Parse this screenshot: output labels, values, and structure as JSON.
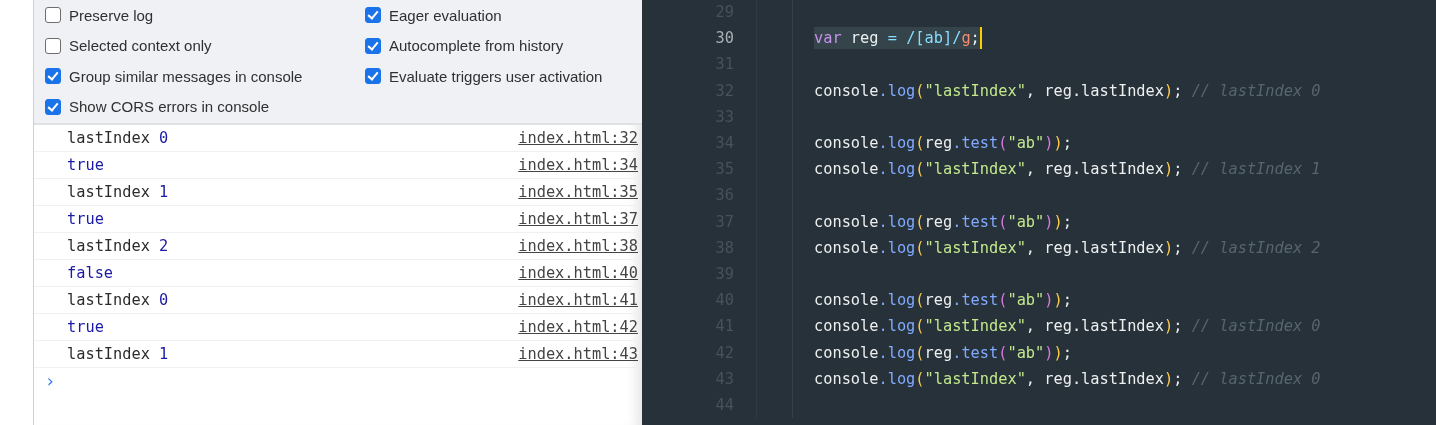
{
  "settings": [
    {
      "label": "Preserve log",
      "checked": false
    },
    {
      "label": "Eager evaluation",
      "checked": true
    },
    {
      "label": "Selected context only",
      "checked": false
    },
    {
      "label": "Autocomplete from history",
      "checked": true
    },
    {
      "label": "Group similar messages in console",
      "checked": true
    },
    {
      "label": "Evaluate triggers user activation",
      "checked": true
    },
    {
      "label": "Show CORS errors in console",
      "checked": true
    }
  ],
  "console_rows": [
    {
      "label": "lastIndex",
      "value": "0",
      "source": "index.html:32"
    },
    {
      "value": "true",
      "source": "index.html:34"
    },
    {
      "label": "lastIndex",
      "value": "1",
      "source": "index.html:35"
    },
    {
      "value": "true",
      "source": "index.html:37"
    },
    {
      "label": "lastIndex",
      "value": "2",
      "source": "index.html:38"
    },
    {
      "value": "false",
      "source": "index.html:40"
    },
    {
      "label": "lastIndex",
      "value": "0",
      "source": "index.html:41"
    },
    {
      "value": "true",
      "source": "index.html:42"
    },
    {
      "label": "lastIndex",
      "value": "1",
      "source": "index.html:43"
    }
  ],
  "console_prompt": "›",
  "editor_lines": [
    {
      "number": "29",
      "current": false
    },
    {
      "number": "30",
      "current": true,
      "tokens": [
        {
          "kind": "keyword",
          "text": "var"
        },
        {
          "kind": "plain",
          "text": " reg "
        },
        {
          "kind": "op",
          "text": "= "
        },
        {
          "kind": "regex",
          "text": "/[ab]/"
        },
        {
          "kind": "flag",
          "text": "g"
        },
        {
          "kind": "plain",
          "text": ";"
        }
      ]
    },
    {
      "number": "31",
      "current": false
    },
    {
      "number": "32",
      "current": false,
      "tokens": [
        {
          "kind": "plain",
          "text": "console"
        },
        {
          "kind": "method",
          "text": ".log"
        },
        {
          "kind": "paren",
          "text": "("
        },
        {
          "kind": "string",
          "text": "\"lastIndex\""
        },
        {
          "kind": "plain",
          "text": ", reg.lastIndex"
        },
        {
          "kind": "paren",
          "text": ")"
        },
        {
          "kind": "plain",
          "text": "; "
        },
        {
          "kind": "comment",
          "text": "// lastIndex 0"
        }
      ]
    },
    {
      "number": "33",
      "current": false
    },
    {
      "number": "34",
      "current": false,
      "tokens": [
        {
          "kind": "plain",
          "text": "console"
        },
        {
          "kind": "method",
          "text": ".log"
        },
        {
          "kind": "paren",
          "text": "("
        },
        {
          "kind": "plain",
          "text": "reg"
        },
        {
          "kind": "method",
          "text": ".test"
        },
        {
          "kind": "paren2",
          "text": "("
        },
        {
          "kind": "string",
          "text": "\"ab\""
        },
        {
          "kind": "paren2",
          "text": ")"
        },
        {
          "kind": "paren",
          "text": ")"
        },
        {
          "kind": "plain",
          "text": ";"
        }
      ]
    },
    {
      "number": "35",
      "current": false,
      "tokens": [
        {
          "kind": "plain",
          "text": "console"
        },
        {
          "kind": "method",
          "text": ".log"
        },
        {
          "kind": "paren",
          "text": "("
        },
        {
          "kind": "string",
          "text": "\"lastIndex\""
        },
        {
          "kind": "plain",
          "text": ", reg.lastIndex"
        },
        {
          "kind": "paren",
          "text": ")"
        },
        {
          "kind": "plain",
          "text": "; "
        },
        {
          "kind": "comment",
          "text": "// lastIndex 1"
        }
      ]
    },
    {
      "number": "36",
      "current": false
    },
    {
      "number": "37",
      "current": false,
      "tokens": [
        {
          "kind": "plain",
          "text": "console"
        },
        {
          "kind": "method",
          "text": ".log"
        },
        {
          "kind": "paren",
          "text": "("
        },
        {
          "kind": "plain",
          "text": "reg"
        },
        {
          "kind": "method",
          "text": ".test"
        },
        {
          "kind": "paren2",
          "text": "("
        },
        {
          "kind": "string",
          "text": "\"ab\""
        },
        {
          "kind": "paren2",
          "text": ")"
        },
        {
          "kind": "paren",
          "text": ")"
        },
        {
          "kind": "plain",
          "text": ";"
        }
      ]
    },
    {
      "number": "38",
      "current": false,
      "tokens": [
        {
          "kind": "plain",
          "text": "console"
        },
        {
          "kind": "method",
          "text": ".log"
        },
        {
          "kind": "paren",
          "text": "("
        },
        {
          "kind": "string",
          "text": "\"lastIndex\""
        },
        {
          "kind": "plain",
          "text": ", reg.lastIndex"
        },
        {
          "kind": "paren",
          "text": ")"
        },
        {
          "kind": "plain",
          "text": "; "
        },
        {
          "kind": "comment",
          "text": "// lastIndex 2"
        }
      ]
    },
    {
      "number": "39",
      "current": false
    },
    {
      "number": "40",
      "current": false,
      "tokens": [
        {
          "kind": "plain",
          "text": "console"
        },
        {
          "kind": "method",
          "text": ".log"
        },
        {
          "kind": "paren",
          "text": "("
        },
        {
          "kind": "plain",
          "text": "reg"
        },
        {
          "kind": "method",
          "text": ".test"
        },
        {
          "kind": "paren2",
          "text": "("
        },
        {
          "kind": "string",
          "text": "\"ab\""
        },
        {
          "kind": "paren2",
          "text": ")"
        },
        {
          "kind": "paren",
          "text": ")"
        },
        {
          "kind": "plain",
          "text": ";"
        }
      ]
    },
    {
      "number": "41",
      "current": false,
      "tokens": [
        {
          "kind": "plain",
          "text": "console"
        },
        {
          "kind": "method",
          "text": ".log"
        },
        {
          "kind": "paren",
          "text": "("
        },
        {
          "kind": "string",
          "text": "\"lastIndex\""
        },
        {
          "kind": "plain",
          "text": ", reg.lastIndex"
        },
        {
          "kind": "paren",
          "text": ")"
        },
        {
          "kind": "plain",
          "text": "; "
        },
        {
          "kind": "comment",
          "text": "// lastIndex 0"
        }
      ]
    },
    {
      "number": "42",
      "current": false,
      "tokens": [
        {
          "kind": "plain",
          "text": "console"
        },
        {
          "kind": "method",
          "text": ".log"
        },
        {
          "kind": "paren",
          "text": "("
        },
        {
          "kind": "plain",
          "text": "reg"
        },
        {
          "kind": "method",
          "text": ".test"
        },
        {
          "kind": "paren2",
          "text": "("
        },
        {
          "kind": "string",
          "text": "\"ab\""
        },
        {
          "kind": "paren2",
          "text": ")"
        },
        {
          "kind": "paren",
          "text": ")"
        },
        {
          "kind": "plain",
          "text": ";"
        }
      ]
    },
    {
      "number": "43",
      "current": false,
      "tokens": [
        {
          "kind": "plain",
          "text": "console"
        },
        {
          "kind": "method",
          "text": ".log"
        },
        {
          "kind": "paren",
          "text": "("
        },
        {
          "kind": "string",
          "text": "\"lastIndex\""
        },
        {
          "kind": "plain",
          "text": ", reg.lastIndex"
        },
        {
          "kind": "paren",
          "text": ")"
        },
        {
          "kind": "plain",
          "text": "; "
        },
        {
          "kind": "comment",
          "text": "// lastIndex 0"
        }
      ]
    },
    {
      "number": "44",
      "current": false
    }
  ]
}
